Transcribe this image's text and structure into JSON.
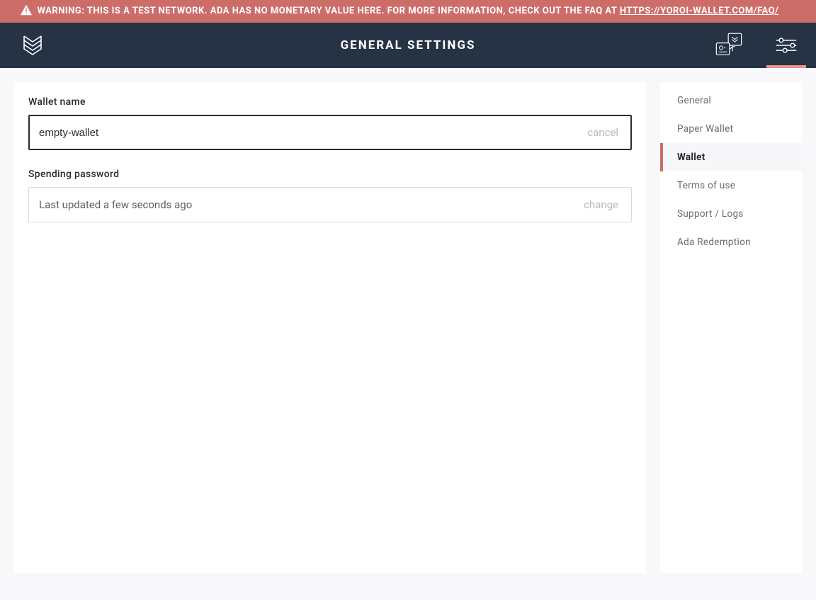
{
  "warning": {
    "text_prefix": "WARNING: THIS IS A TEST NETWORK. ADA HAS NO MONETARY VALUE HERE. FOR MORE INFORMATION, CHECK OUT THE FAQ AT ",
    "link_text": "HTTPS://YOROI-WALLET.COM/FAQ/"
  },
  "header": {
    "title": "GENERAL SETTINGS"
  },
  "wallet_name": {
    "label": "Wallet name",
    "value": "empty-wallet",
    "action": "cancel"
  },
  "spending_password": {
    "label": "Spending password",
    "status": "Last updated a few seconds ago",
    "action": "change"
  },
  "sidebar": {
    "items": [
      {
        "label": "General",
        "active": false
      },
      {
        "label": "Paper Wallet",
        "active": false
      },
      {
        "label": "Wallet",
        "active": true
      },
      {
        "label": "Terms of use",
        "active": false
      },
      {
        "label": "Support / Logs",
        "active": false
      },
      {
        "label": "Ada Redemption",
        "active": false
      }
    ]
  }
}
